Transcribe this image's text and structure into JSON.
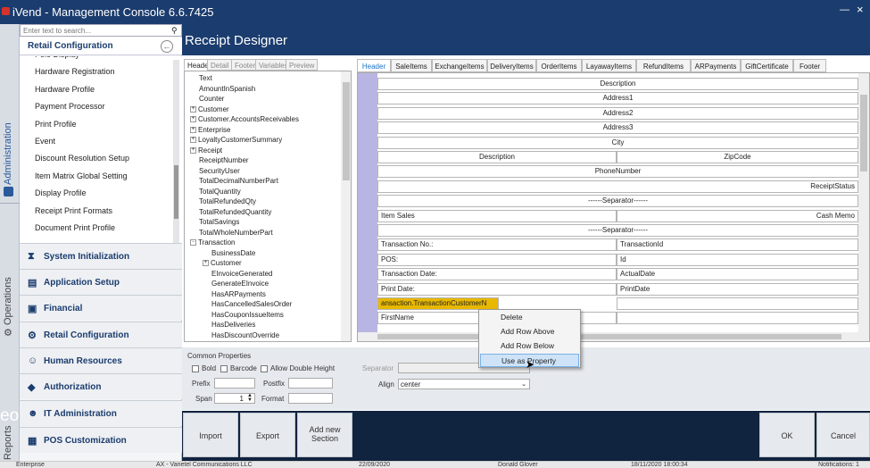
{
  "app": {
    "title": "iVend - Management Console  6.6.7425"
  },
  "left_strip": {
    "admin": "Administration",
    "operations": "Operations",
    "reports": "Reports"
  },
  "nav": {
    "search_placeholder": "Enter text to search...",
    "header": "Retail Configuration",
    "items": [
      "Pole Display",
      "Hardware Registration",
      "Hardware Profile",
      "Payment Processor",
      "Print Profile",
      "Event",
      "Discount Resolution Setup",
      "Item Matrix Global Setting",
      "Display Profile",
      "Receipt Print Formats",
      "Document Print Profile"
    ],
    "sections": [
      "System Initialization",
      "Application Setup",
      "Financial",
      "Retail Configuration",
      "Human Resources",
      "Authorization",
      "IT Administration",
      "POS Customization"
    ]
  },
  "designer": {
    "title": "Receipt Designer",
    "left_tabs": [
      "Header",
      "Detail",
      "Footer",
      "Variables",
      "Preview"
    ],
    "tree": [
      {
        "label": "Text",
        "level": 0,
        "exp": ""
      },
      {
        "label": "AmountInSpanish",
        "level": 0,
        "exp": ""
      },
      {
        "label": "Counter",
        "level": 0,
        "exp": ""
      },
      {
        "label": "Customer",
        "level": 0,
        "exp": "+"
      },
      {
        "label": "Customer.AccountsReceivables",
        "level": 0,
        "exp": "+"
      },
      {
        "label": "Enterprise",
        "level": 0,
        "exp": "+"
      },
      {
        "label": "LoyaltyCustomerSummary",
        "level": 0,
        "exp": "+"
      },
      {
        "label": "Receipt",
        "level": 0,
        "exp": "+"
      },
      {
        "label": "ReceiptNumber",
        "level": 0,
        "exp": ""
      },
      {
        "label": "SecurityUser",
        "level": 0,
        "exp": ""
      },
      {
        "label": "TotalDecimalNumberPart",
        "level": 0,
        "exp": ""
      },
      {
        "label": "TotalQuantity",
        "level": 0,
        "exp": ""
      },
      {
        "label": "TotalRefundedQty",
        "level": 0,
        "exp": ""
      },
      {
        "label": "TotalRefundedQuantity",
        "level": 0,
        "exp": ""
      },
      {
        "label": "TotalSavings",
        "level": 0,
        "exp": ""
      },
      {
        "label": "TotalWholeNumberPart",
        "level": 0,
        "exp": ""
      },
      {
        "label": "Transaction",
        "level": 0,
        "exp": "-"
      },
      {
        "label": "BusinessDate",
        "level": 1,
        "exp": ""
      },
      {
        "label": "Customer",
        "level": 1,
        "exp": "+"
      },
      {
        "label": "EInvoiceGenerated",
        "level": 1,
        "exp": ""
      },
      {
        "label": "GenerateEInvoice",
        "level": 1,
        "exp": ""
      },
      {
        "label": "HasARPayments",
        "level": 1,
        "exp": ""
      },
      {
        "label": "HasCancelledSalesOrder",
        "level": 1,
        "exp": ""
      },
      {
        "label": "HasCouponIssueItems",
        "level": 1,
        "exp": ""
      },
      {
        "label": "HasDeliveries",
        "level": 1,
        "exp": ""
      },
      {
        "label": "HasDiscountOverride",
        "level": 1,
        "exp": ""
      }
    ],
    "section_tabs": [
      "Header",
      "SaleItems",
      "ExchangeItems",
      "DeliveryItems",
      "OrderItems",
      "LayawayItems",
      "RefundItems",
      "ARPayments",
      "GiftCertificate",
      "Footer"
    ],
    "rows": [
      [
        {
          "t": "Description",
          "a": "c",
          "s": 2
        }
      ],
      [
        {
          "t": "Address1",
          "a": "c",
          "s": 2
        }
      ],
      [
        {
          "t": "Address2",
          "a": "c",
          "s": 2
        }
      ],
      [
        {
          "t": "Address3",
          "a": "c",
          "s": 2
        }
      ],
      [
        {
          "t": "City",
          "a": "c",
          "s": 2
        }
      ],
      [
        {
          "t": "Description",
          "a": "c",
          "s": 1
        },
        {
          "t": "ZipCode",
          "a": "c",
          "s": 1
        }
      ],
      [
        {
          "t": "PhoneNumber",
          "a": "c",
          "s": 2
        }
      ],
      [
        {
          "t": "ReceiptStatus",
          "a": "r",
          "s": 2
        }
      ],
      [
        {
          "t": "------Separator------",
          "a": "c",
          "s": 2
        }
      ],
      [
        {
          "t": "Item Sales",
          "a": "l",
          "s": 1
        },
        {
          "t": "Cash Memo",
          "a": "r",
          "s": 1
        }
      ],
      [
        {
          "t": "------Separator------",
          "a": "c",
          "s": 2
        }
      ],
      [
        {
          "t": "Transaction No.:",
          "a": "l",
          "s": 1
        },
        {
          "t": "TransactionId",
          "a": "l",
          "s": 1
        }
      ],
      [
        {
          "t": "POS:",
          "a": "l",
          "s": 1
        },
        {
          "t": "Id",
          "a": "l",
          "s": 1
        }
      ],
      [
        {
          "t": "Transaction Date:",
          "a": "l",
          "s": 1
        },
        {
          "t": "ActualDate",
          "a": "l",
          "s": 1
        }
      ],
      [
        {
          "t": "Print Date:",
          "a": "l",
          "s": 1
        },
        {
          "t": "PrintDate",
          "a": "l",
          "s": 1
        }
      ],
      [
        {
          "t": "ansaction.TransactionCustomerN",
          "a": "l",
          "s": 1,
          "hl": true
        },
        {
          "t": "",
          "a": "l",
          "s": 1
        }
      ],
      [
        {
          "t": "FirstName",
          "a": "l",
          "s": 1
        },
        {
          "t": "",
          "a": "l",
          "s": 1
        }
      ]
    ],
    "highlight_color": "#e8b800"
  },
  "props": {
    "title": "Common Properties",
    "bold": "Bold",
    "barcode": "Barcode",
    "allow_double_height": "Allow Double Height",
    "prefix": "Prefix",
    "postfix": "Postfix",
    "span": "Span",
    "span_value": "1",
    "format": "Format",
    "separator": "Separator",
    "align": "Align",
    "align_value": "center"
  },
  "buttons": {
    "import": "Import",
    "export": "Export",
    "add_new_section": "Add new Section",
    "ok": "OK",
    "cancel": "Cancel"
  },
  "context_menu": {
    "items": [
      "Delete",
      "Add Row Above",
      "Add Row Below",
      "Use as Property"
    ]
  },
  "status_bar": {
    "enterprise": "Enterprise",
    "company": "AX - Varietel Communications LLC",
    "date1": "22/09/2020",
    "user": "Donald Glover",
    "datetime": "18/11/2020 18:00:34",
    "notifications": "Notifications: 1"
  },
  "overlay_text": "eo"
}
